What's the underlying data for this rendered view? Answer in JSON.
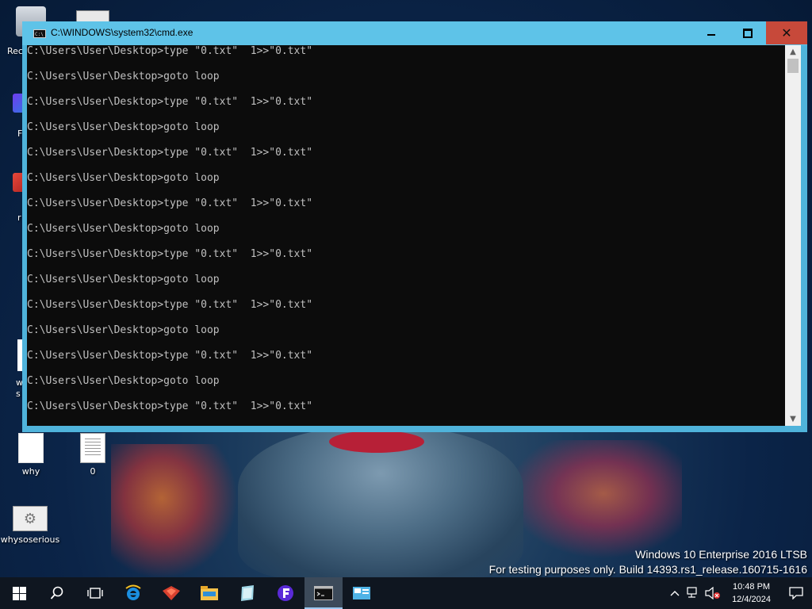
{
  "window": {
    "title": "C:\\WINDOWS\\system32\\cmd.exe",
    "close_label": "✕",
    "icon_text": "C:\\"
  },
  "console_lines": [
    "C:\\Users\\User\\Desktop>type \"0.txt\"  1>>\"0.txt\"",
    "C:\\Users\\User\\Desktop>goto loop",
    "C:\\Users\\User\\Desktop>type \"0.txt\"  1>>\"0.txt\"",
    "C:\\Users\\User\\Desktop>goto loop",
    "C:\\Users\\User\\Desktop>type \"0.txt\"  1>>\"0.txt\"",
    "C:\\Users\\User\\Desktop>goto loop",
    "C:\\Users\\User\\Desktop>type \"0.txt\"  1>>\"0.txt\"",
    "C:\\Users\\User\\Desktop>goto loop",
    "C:\\Users\\User\\Desktop>type \"0.txt\"  1>>\"0.txt\"",
    "C:\\Users\\User\\Desktop>goto loop",
    "C:\\Users\\User\\Desktop>type \"0.txt\"  1>>\"0.txt\"",
    "C:\\Users\\User\\Desktop>goto loop",
    "C:\\Users\\User\\Desktop>type \"0.txt\"  1>>\"0.txt\"",
    "C:\\Users\\User\\Desktop>goto loop",
    "C:\\Users\\User\\Desktop>type \"0.txt\"  1>>\"0.txt\""
  ],
  "desktop": {
    "icons": [
      {
        "label": "why"
      },
      {
        "label": "0"
      },
      {
        "label": "whysoserious"
      }
    ],
    "partial_labels": [
      "Rec",
      "F",
      "r",
      "w",
      "s"
    ]
  },
  "watermark": {
    "line1": "Windows 10 Enterprise 2016 LTSB",
    "line2": "For testing purposes only. Build 14393.rs1_release.160715-1616"
  },
  "taskbar": {
    "time": "10:48 PM",
    "date": "12/4/2024"
  }
}
